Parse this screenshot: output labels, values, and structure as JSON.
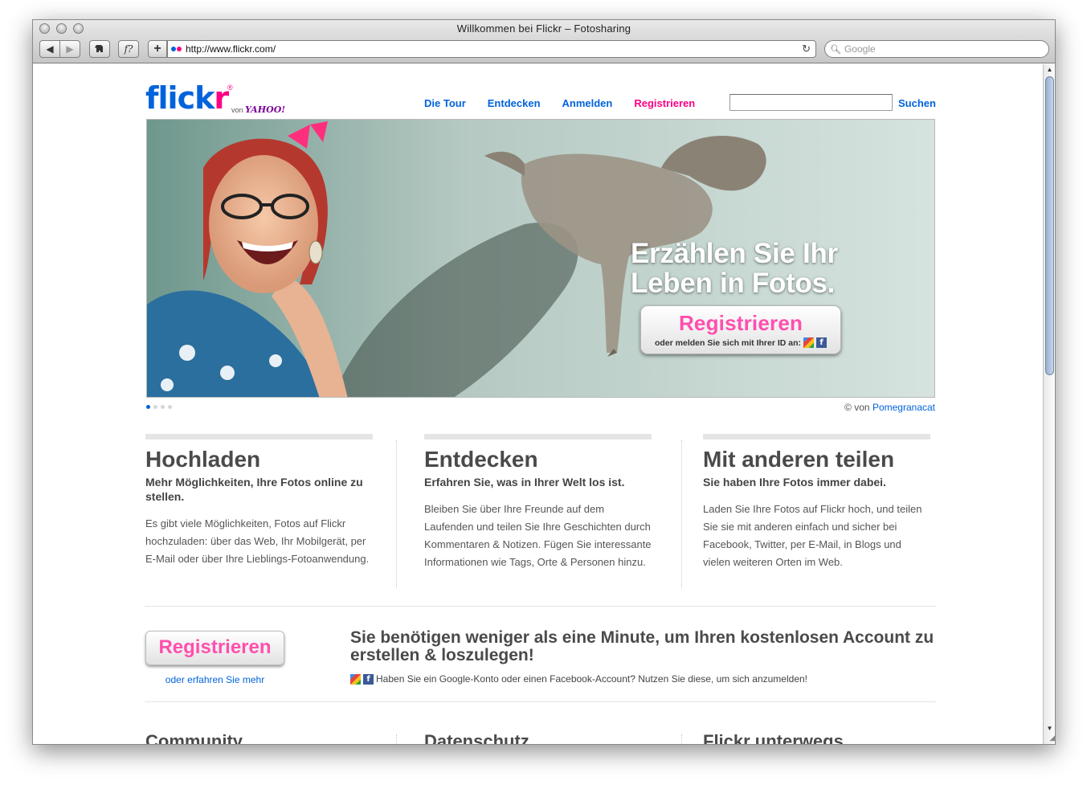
{
  "browser": {
    "window_title": "Willkommen bei Flickr – Fotosharing",
    "url": "http://www.flickr.com/",
    "search_placeholder": "Google",
    "buttons": {
      "back": "◀",
      "forward": "▶",
      "plus": "+",
      "f": "f?"
    }
  },
  "header": {
    "logo": {
      "part1": "flick",
      "part2": "r",
      "reg": "®",
      "von": "von",
      "yahoo": "YAHOO!"
    },
    "nav": [
      "Die Tour",
      "Entdecken",
      "Anmelden",
      "Registrieren"
    ],
    "search_button": "Suchen",
    "search_value": ""
  },
  "hero": {
    "headline_line1": "Erzählen Sie Ihr",
    "headline_line2": "Leben in Fotos.",
    "cta_label": "Registrieren",
    "cta_sub": "oder melden Sie sich mit Ihrer ID an:",
    "credit_prefix": "© von",
    "credit_author": "Pomegranacat",
    "active_slide": 1,
    "slide_count": 4
  },
  "features": [
    {
      "title": "Hochladen",
      "subtitle": "Mehr Möglichkeiten, Ihre Fotos online zu stellen.",
      "text": "Es gibt viele Möglichkeiten, Fotos auf Flickr hochzuladen: über das Web, Ihr Mobilgerät, per E-Mail oder über Ihre Lieblings-Fotoanwendung."
    },
    {
      "title": "Entdecken",
      "subtitle": "Erfahren Sie, was in Ihrer Welt los ist.",
      "text": "Bleiben Sie über Ihre Freunde auf dem Laufenden und teilen Sie Ihre Geschichten durch Kommentaren & Notizen. Fügen Sie interessante Informationen wie Tags, Orte & Personen hinzu."
    },
    {
      "title": "Mit anderen teilen",
      "subtitle": "Sie haben Ihre Fotos immer dabei.",
      "text": "Laden Sie Ihre Fotos auf Flickr hoch, und teilen Sie sie mit anderen einfach und sicher bei Facebook, Twitter, per E-Mail, in Blogs und vielen weiteren Orten im Web."
    }
  ],
  "signup": {
    "button": "Registrieren",
    "learn_more": "oder erfahren Sie mehr",
    "headline": "Sie benötigen weniger als eine Minute, um Ihren kostenlosen Account zu erstellen & loszulegen!",
    "note": "Haben Sie ein Google-Konto oder einen Facebook-Account? Nutzen Sie diese, um sich anzumelden!"
  },
  "bottom_sections": [
    "Community",
    "Datenschutz",
    "Flickr unterwegs"
  ],
  "colors": {
    "flickr_blue": "#0063dc",
    "flickr_pink": "#ff0084",
    "cta_pink": "#ff4fae"
  }
}
